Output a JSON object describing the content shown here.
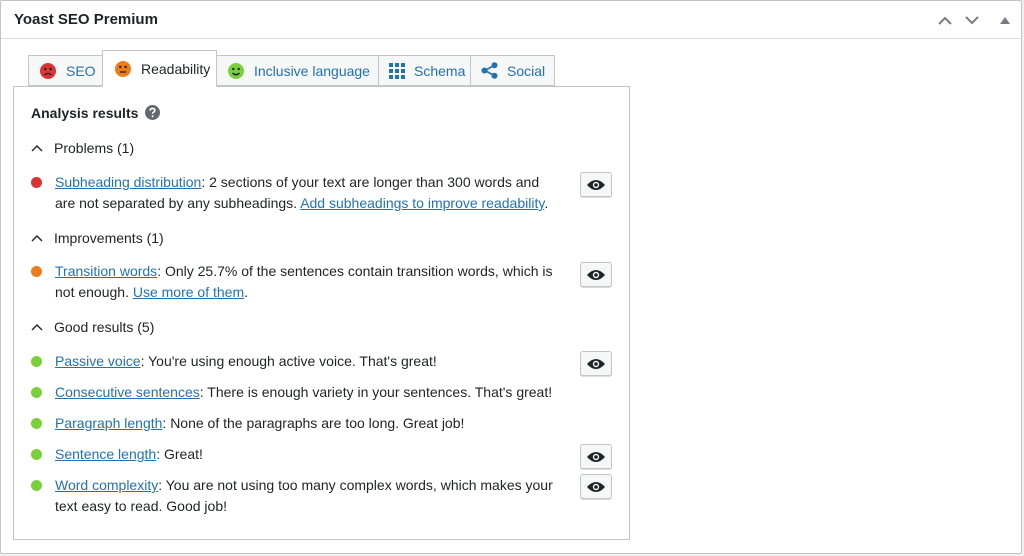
{
  "metabox": {
    "title": "Yoast SEO Premium"
  },
  "tabs": [
    {
      "label": "SEO",
      "icon": "sad-face-icon",
      "color": "#dc3232"
    },
    {
      "label": "Readability",
      "icon": "neutral-face-icon",
      "color": "#ee7c1b"
    },
    {
      "label": "Inclusive language",
      "icon": "happy-face-icon",
      "color": "#7ad03a"
    },
    {
      "label": "Schema",
      "icon": "grid-icon",
      "color": "#2271b1"
    },
    {
      "label": "Social",
      "icon": "share-icon",
      "color": "#2271b1"
    }
  ],
  "analysis": {
    "title": "Analysis results",
    "problems": {
      "heading": "Problems (1)",
      "items": [
        {
          "link": "Subheading distribution",
          "text": ": 2 sections of your text are longer than 300 words and are not separated by any subheadings. ",
          "action": "Add subheadings to improve readability",
          "end": "."
        }
      ]
    },
    "improvements": {
      "heading": "Improvements (1)",
      "items": [
        {
          "link": "Transition words",
          "text": ": Only 25.7% of the sentences contain transition words, which is not enough. ",
          "action": "Use more of them",
          "end": "."
        }
      ]
    },
    "good": {
      "heading": "Good results (5)",
      "items": [
        {
          "link": "Passive voice",
          "text": ": You're using enough active voice. That's great!"
        },
        {
          "link": "Consecutive sentences",
          "text": ": There is enough variety in your sentences. That's great!"
        },
        {
          "link": "Paragraph length",
          "text": ": None of the paragraphs are too long. Great job!"
        },
        {
          "link": "Sentence length",
          "text": ": Great!"
        },
        {
          "link": "Word complexity",
          "text": ": You are not using too many complex words, which makes your text easy to read. Good job!"
        }
      ]
    }
  },
  "colors": {
    "problem": "#dc3232",
    "improvement": "#ee7c1b",
    "good": "#7ad03a",
    "link": "#2271b1"
  }
}
